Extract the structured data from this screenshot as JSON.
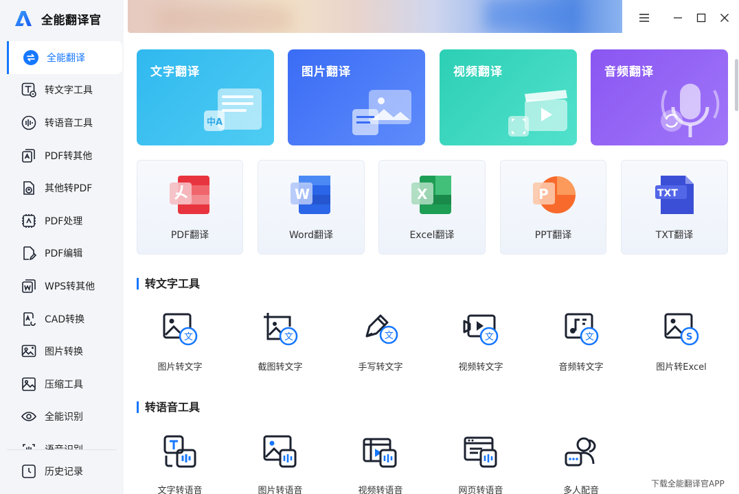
{
  "app": {
    "name": "全能翻译官"
  },
  "sidebar": {
    "items": [
      {
        "label": "全能翻译",
        "icon": "translate-icon",
        "active": true
      },
      {
        "label": "转文字工具",
        "icon": "text-tool-icon"
      },
      {
        "label": "转语音工具",
        "icon": "voice-tool-icon"
      },
      {
        "label": "PDF转其他",
        "icon": "pdf-convert-icon"
      },
      {
        "label": "其他转PDF",
        "icon": "to-pdf-icon"
      },
      {
        "label": "PDF处理",
        "icon": "pdf-process-icon"
      },
      {
        "label": "PDF编辑",
        "icon": "pdf-edit-icon"
      },
      {
        "label": "WPS转其他",
        "icon": "wps-convert-icon"
      },
      {
        "label": "CAD转换",
        "icon": "cad-convert-icon"
      },
      {
        "label": "图片转换",
        "icon": "image-convert-icon"
      },
      {
        "label": "压缩工具",
        "icon": "compress-icon"
      },
      {
        "label": "全能识别",
        "icon": "recognize-icon"
      },
      {
        "label": "语音识别",
        "icon": "speech-recognize-icon"
      }
    ],
    "history": {
      "label": "历史记录",
      "icon": "history-icon"
    }
  },
  "translate_cards": [
    {
      "title": "文字翻译",
      "color_start": "#30b8ef",
      "color_end": "#4fcdf3"
    },
    {
      "title": "图片翻译",
      "color_start": "#3a6cf5",
      "color_end": "#5f8cfb"
    },
    {
      "title": "视频翻译",
      "color_start": "#2ccfb5",
      "color_end": "#52e1cc"
    },
    {
      "title": "音频翻译",
      "color_start": "#8a56f2",
      "color_end": "#a076f9"
    }
  ],
  "doc_cards": [
    {
      "label": "PDF翻译",
      "icon": "pdf-file-icon",
      "color": "#e8343e"
    },
    {
      "label": "Word翻译",
      "icon": "word-file-icon",
      "color": "#2b66e8"
    },
    {
      "label": "Excel翻译",
      "icon": "excel-file-icon",
      "color": "#1e9e55"
    },
    {
      "label": "PPT翻译",
      "icon": "ppt-file-icon",
      "color": "#f76a2c"
    },
    {
      "label": "TXT翻译",
      "icon": "txt-file-icon",
      "color": "#3b4fd6"
    }
  ],
  "sections": {
    "text_tools": {
      "title": "转文字工具",
      "items": [
        {
          "label": "图片转文字",
          "icon": "image-to-text-icon"
        },
        {
          "label": "截图转文字",
          "icon": "screenshot-to-text-icon"
        },
        {
          "label": "手写转文字",
          "icon": "handwriting-to-text-icon"
        },
        {
          "label": "视频转文字",
          "icon": "video-to-text-icon"
        },
        {
          "label": "音频转文字",
          "icon": "audio-to-text-icon"
        },
        {
          "label": "图片转Excel",
          "icon": "image-to-excel-icon"
        }
      ]
    },
    "voice_tools": {
      "title": "转语音工具",
      "items": [
        {
          "label": "文字转语音",
          "icon": "text-to-speech-icon"
        },
        {
          "label": "图片转语音",
          "icon": "image-to-speech-icon"
        },
        {
          "label": "视频转语音",
          "icon": "video-to-speech-icon"
        },
        {
          "label": "网页转语音",
          "icon": "webpage-to-speech-icon"
        },
        {
          "label": "多人配音",
          "icon": "multi-voice-dubbing-icon"
        }
      ]
    }
  },
  "footer": {
    "download_label": "下载全能翻译官APP"
  },
  "colors": {
    "accent": "#1677ff",
    "sidebar_bg": "#f3f5f8",
    "icon_dark": "#1c2230"
  }
}
